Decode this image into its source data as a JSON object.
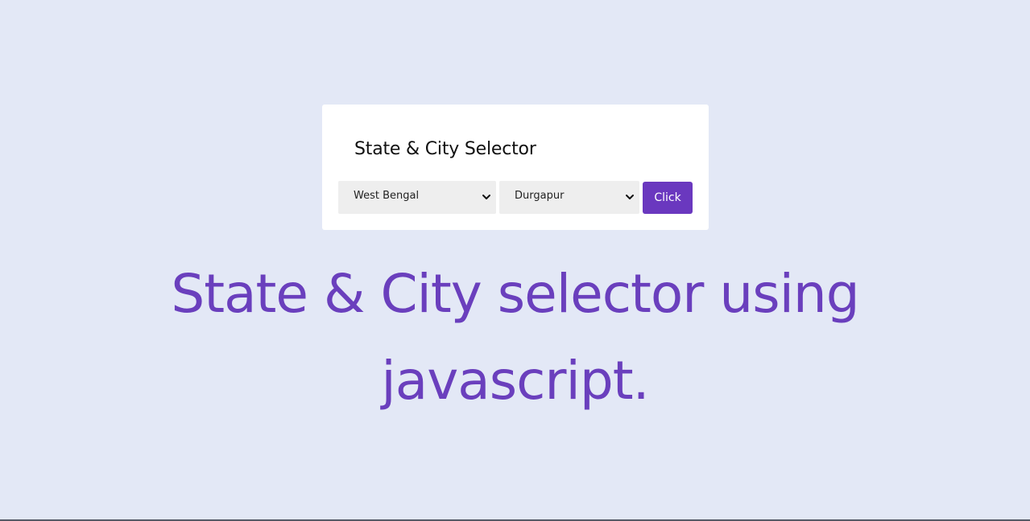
{
  "card": {
    "title": "State & City Selector",
    "state_select": {
      "value": "West Bengal"
    },
    "city_select": {
      "value": "Durgapur"
    },
    "button_label": "Click"
  },
  "headline": {
    "line1": "State & City selector using",
    "line2": "javascript."
  },
  "colors": {
    "background": "#e3e8f6",
    "accent": "#6a38bf",
    "card": "#ffffff",
    "select_background": "#eeeeee"
  }
}
